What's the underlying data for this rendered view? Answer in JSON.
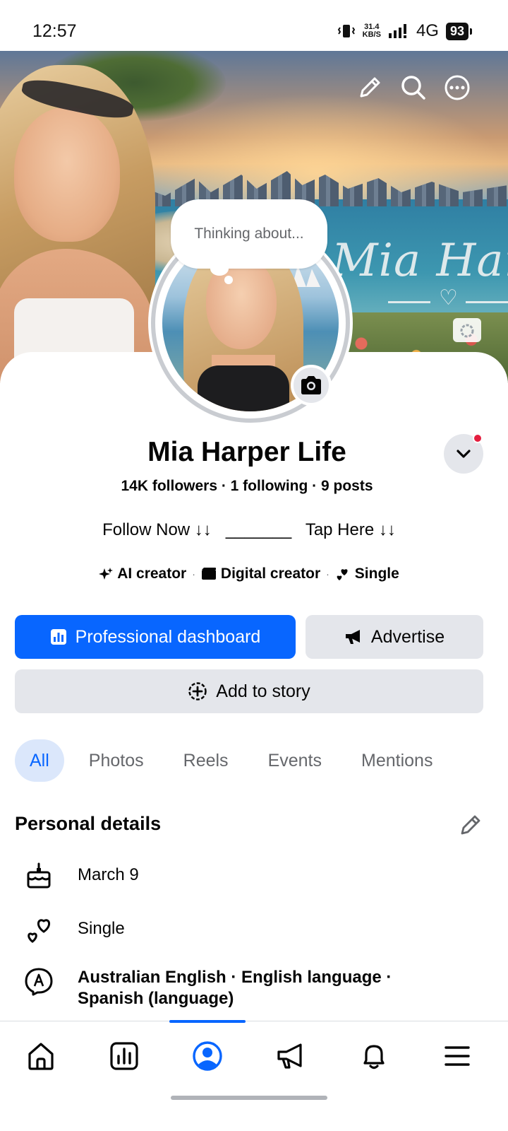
{
  "status_bar": {
    "time": "12:57",
    "net_speed_value": "31.4",
    "net_speed_unit": "KB/S",
    "network": "4G",
    "battery": "93"
  },
  "cover": {
    "script_text": "Mia Harper"
  },
  "thought_bubble": {
    "placeholder": "Thinking about..."
  },
  "profile": {
    "name": "Mia Harper Life",
    "stats": "14K followers · 1 following · 9 posts",
    "bio": "Follow Now ↓↓   _______   Tap Here ↓↓",
    "tags": [
      {
        "icon": "sparkle-icon",
        "label": "AI creator"
      },
      {
        "icon": "clapperboard-icon",
        "label": "Digital creator"
      },
      {
        "icon": "hearts-icon",
        "label": "Single"
      }
    ]
  },
  "buttons": {
    "dashboard": "Professional dashboard",
    "advertise": "Advertise",
    "add_story": "Add to story"
  },
  "tabs": [
    {
      "label": "All",
      "active": true
    },
    {
      "label": "Photos",
      "active": false
    },
    {
      "label": "Reels",
      "active": false
    },
    {
      "label": "Events",
      "active": false
    },
    {
      "label": "Mentions",
      "active": false
    }
  ],
  "personal_details": {
    "title": "Personal details",
    "items": [
      {
        "icon": "birthday-cake-icon",
        "text": "March 9"
      },
      {
        "icon": "relationship-hearts-icon",
        "text": "Single"
      },
      {
        "icon": "language-icon",
        "text": "Australian English · English language · Spanish (language)"
      }
    ]
  },
  "bottom_nav": [
    {
      "icon": "home-icon",
      "active": false
    },
    {
      "icon": "dashboard-icon",
      "active": false
    },
    {
      "icon": "profile-icon",
      "active": true
    },
    {
      "icon": "megaphone-icon",
      "active": false
    },
    {
      "icon": "bell-icon",
      "active": false
    },
    {
      "icon": "menu-icon",
      "active": false
    }
  ],
  "colors": {
    "accent": "#0866ff",
    "button_gray": "#e4e6eb",
    "notification_red": "#e41e3f",
    "secondary_text": "#65676b"
  }
}
